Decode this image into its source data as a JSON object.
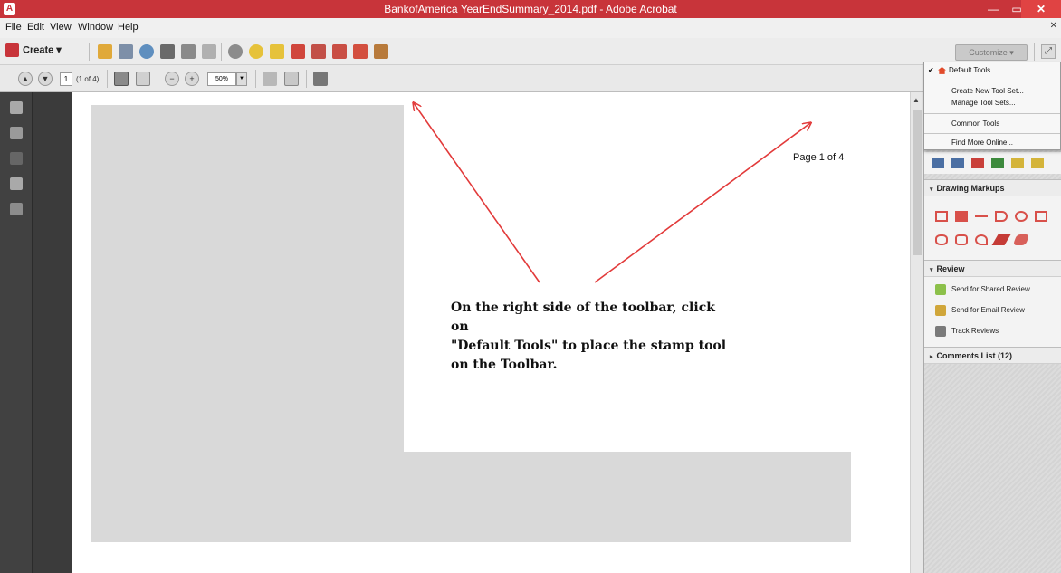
{
  "window": {
    "title": "BankofAmerica YearEndSummary_2014.pdf - Adobe Acrobat",
    "app_icon_label": "A",
    "minimize": "—",
    "maximize": "▭",
    "close": "✕"
  },
  "menubar": {
    "items": [
      "File",
      "Edit",
      "View",
      "Window",
      "Help"
    ],
    "close_glyph": "✕"
  },
  "toolbar": {
    "create_label": "Create ▾",
    "customize_label": "Customize ▾",
    "expand_glyph": "⤢"
  },
  "navbar": {
    "page_current": "1",
    "page_of": "(1 of 4)",
    "zoom": "50%",
    "zoom_dropdown": "▼",
    "prev_glyph": "▲",
    "next_glyph": "▼",
    "zoom_out_glyph": "−",
    "zoom_in_glyph": "+"
  },
  "document": {
    "page_number": "Page 1 of 4",
    "instruction_lines": [
      "On the right side of the toolbar, click on",
      "\"Default Tools\" to place the stamp tool",
      "on the Toolbar."
    ]
  },
  "dropdown_menu": {
    "default_tools": "Default Tools",
    "check": "✔",
    "create_new": "Create New Tool Set...",
    "manage": "Manage Tool Sets...",
    "common_tools": "Common Tools",
    "find_more": "Find More Online..."
  },
  "right_panel": {
    "drawing_markups": "Drawing Markups",
    "review": "Review",
    "send_shared": "Send for Shared Review",
    "send_email": "Send for Email Review",
    "track_reviews": "Track Reviews",
    "comments_list": "Comments List (12)",
    "collapse_tri": "▾",
    "expand_tri": "▸"
  },
  "colors": {
    "titlebar": "#c8343a",
    "arrow": "#e23a3a",
    "redaction": "#d9d9d9"
  },
  "icons": [
    "create-icon",
    "open-icon",
    "save-icon",
    "cloud-icon",
    "print-icon",
    "edit-icon",
    "email-icon",
    "gear-icon",
    "comment-icon",
    "sticky-note-icon",
    "pdf-icon",
    "pdf-export-icon",
    "pdf-combine-icon",
    "pdf-secure-icon",
    "stamp-icon"
  ]
}
